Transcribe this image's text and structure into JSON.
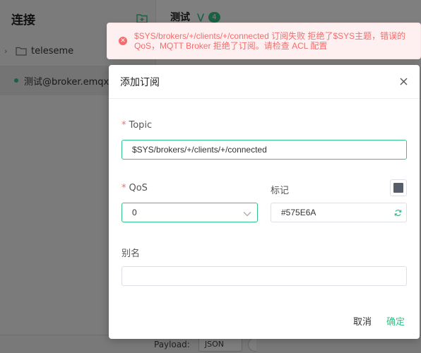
{
  "sidebar": {
    "title": "连接",
    "folder": {
      "name": "teleseme"
    },
    "connection": {
      "name": "测试@broker.emqx.io"
    }
  },
  "main": {
    "title": "测试",
    "subscription_count": "4"
  },
  "footer": {
    "payload_label": "Payload:",
    "payload_format": "JSON"
  },
  "toast": {
    "message": "$SYS/brokers/+/clients/+/connected 订阅失败 拒绝了$SYS主题，错误的QoS，MQTT Broker 拒绝了订阅。请检查 ACL 配置",
    "color": "#f56c6c"
  },
  "dialog": {
    "title": "添加订阅",
    "topic": {
      "label": "Topic",
      "value": "$SYS/brokers/+/clients/+/connected"
    },
    "qos": {
      "label": "QoS",
      "value": "0"
    },
    "color_tag": {
      "label": "标记",
      "value": "#575E6A"
    },
    "alias": {
      "label": "别名",
      "value": ""
    },
    "cancel_label": "取消",
    "confirm_label": "确定"
  },
  "colors": {
    "accent": "#34c388",
    "error": "#f56c6c",
    "tag": "#575E6A"
  }
}
